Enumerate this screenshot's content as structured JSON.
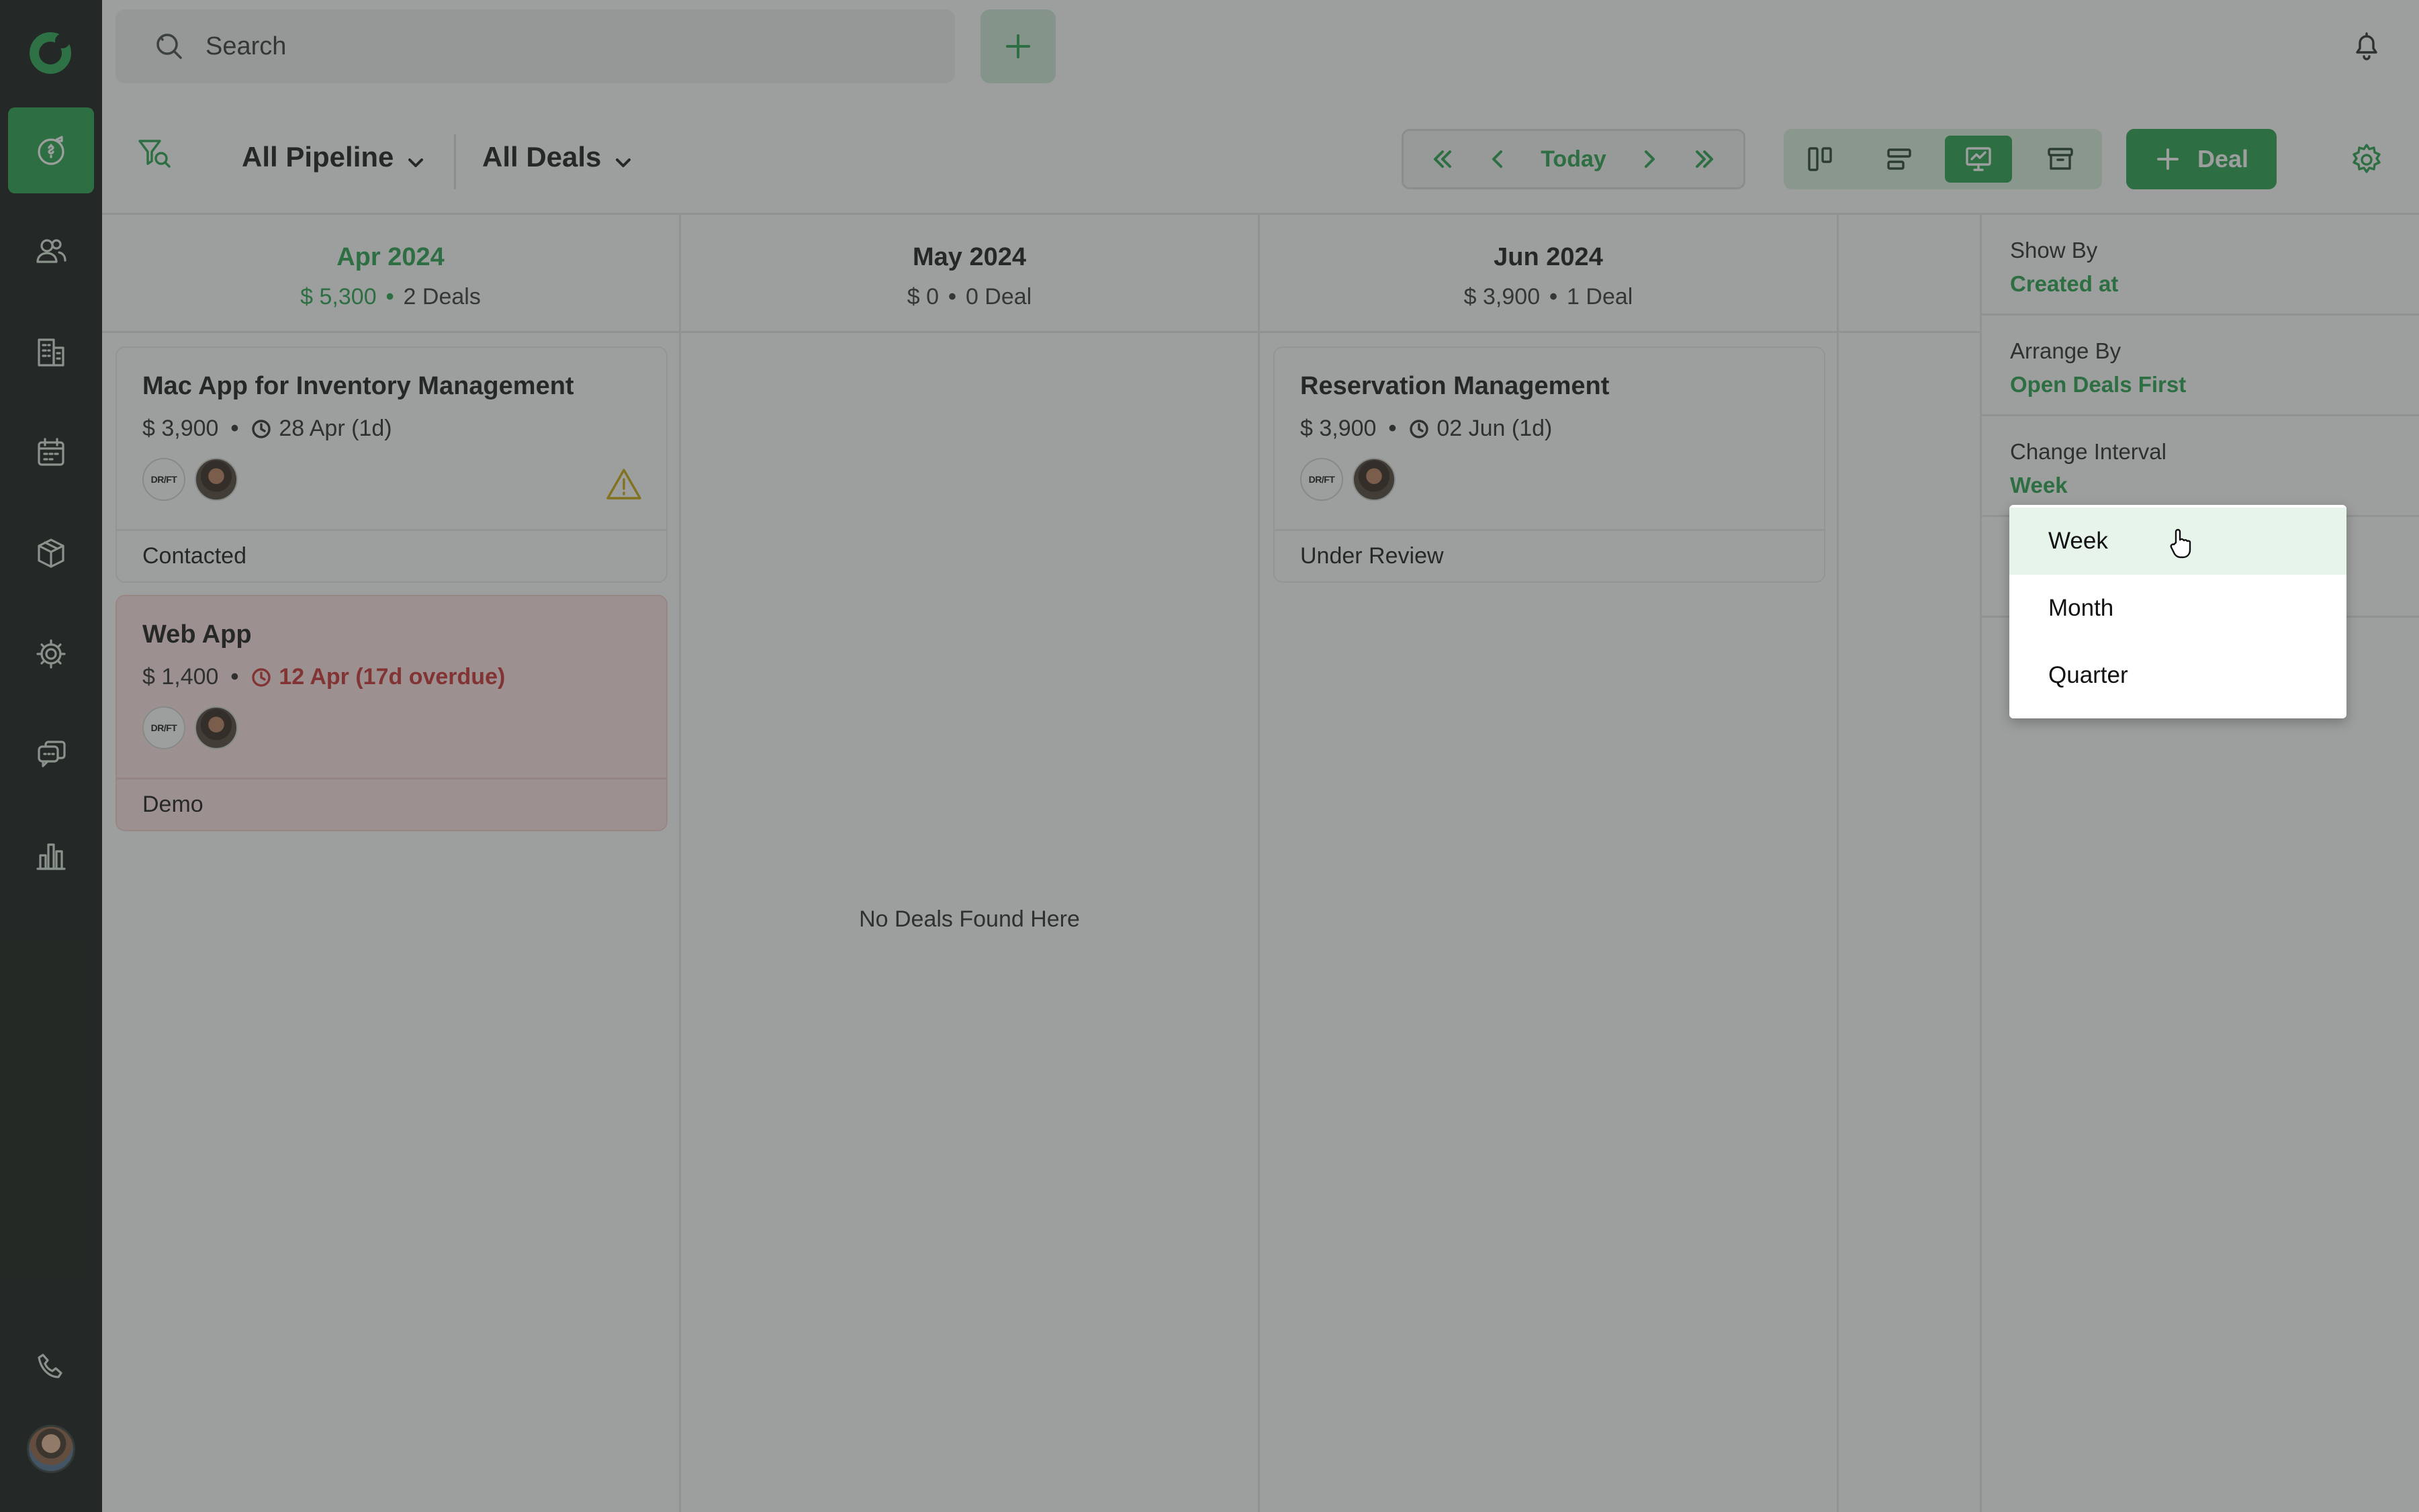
{
  "topbar": {
    "search_placeholder": "Search"
  },
  "toolbar": {
    "pipeline_label": "All Pipeline",
    "deals_filter_label": "All Deals",
    "today_label": "Today",
    "new_deal_label": "Deal"
  },
  "columns": [
    {
      "month": "Apr 2024",
      "amount": "$ 5,300",
      "count": "2 Deals",
      "cards": [
        {
          "title": "Mac App for Inventory Management",
          "amount": "$ 3,900",
          "date": "28 Apr (1d)",
          "stage": "Contacted",
          "logo_text": "DR/FT"
        },
        {
          "title": "Web App",
          "amount": "$ 1,400",
          "date": "12 Apr (17d overdue)",
          "stage": "Demo",
          "logo_text": "DR/FT"
        }
      ]
    },
    {
      "month": "May 2024",
      "amount": "$ 0",
      "count": "0 Deal",
      "empty_message": "No Deals Found Here"
    },
    {
      "month": "Jun 2024",
      "amount": "$ 3,900",
      "count": "1 Deal",
      "cards": [
        {
          "title": "Reservation Management",
          "amount": "$ 3,900",
          "date": "02 Jun (1d)",
          "stage": "Under Review",
          "logo_text": "DR/FT"
        }
      ]
    }
  ],
  "panel": {
    "show_by_label": "Show By",
    "show_by_value": "Created at",
    "arrange_by_label": "Arrange By",
    "arrange_by_value": "Open Deals First",
    "interval_label": "Change Interval",
    "interval_value": "Week"
  },
  "interval_menu": {
    "options": [
      "Week",
      "Month",
      "Quarter"
    ],
    "hovered": "Week"
  },
  "colors": {
    "accent": "#1e9d46",
    "overdue": "#c62828",
    "warning": "#c9a400",
    "rail": "#0c110e"
  },
  "icons": {
    "rail": [
      "deals-icon",
      "contacts-icon",
      "companies-icon",
      "calendar-icon",
      "products-icon",
      "settings-icon",
      "chat-icon",
      "reports-icon",
      "phone-icon"
    ]
  }
}
